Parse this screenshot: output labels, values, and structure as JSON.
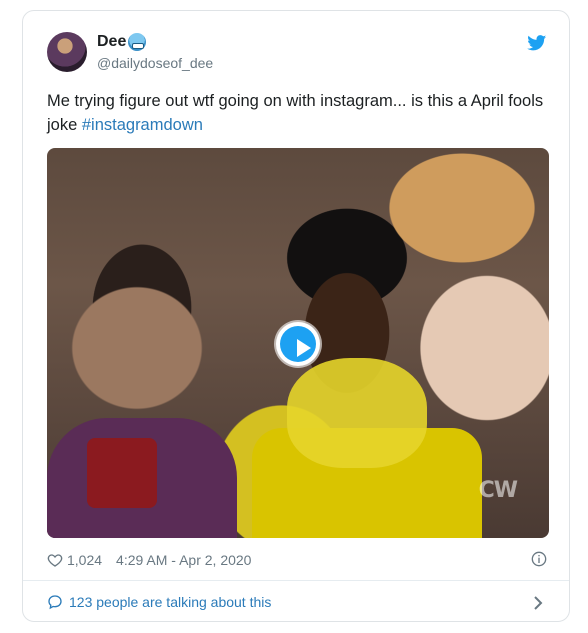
{
  "author": {
    "display_name": "Dee",
    "handle": "@dailydoseof_dee"
  },
  "tweet": {
    "text": "Me trying figure out wtf going on with instagram... is this a April fools joke ",
    "hashtag": "#instagramdown"
  },
  "media": {
    "watermark": "CW"
  },
  "footer": {
    "likes": "1,024",
    "timestamp": "4:29 AM - Apr 2, 2020",
    "talking": "123 people are talking about this"
  },
  "colors": {
    "link_blue": "#2b7bb9",
    "twitter_blue": "#1da1f2",
    "muted_gray": "#697882"
  },
  "icons": [
    "twitter-bird-icon",
    "play-icon",
    "heart-icon",
    "info-icon",
    "speech-bubble-icon",
    "chevron-right-icon",
    "grimace-emoji-icon"
  ]
}
